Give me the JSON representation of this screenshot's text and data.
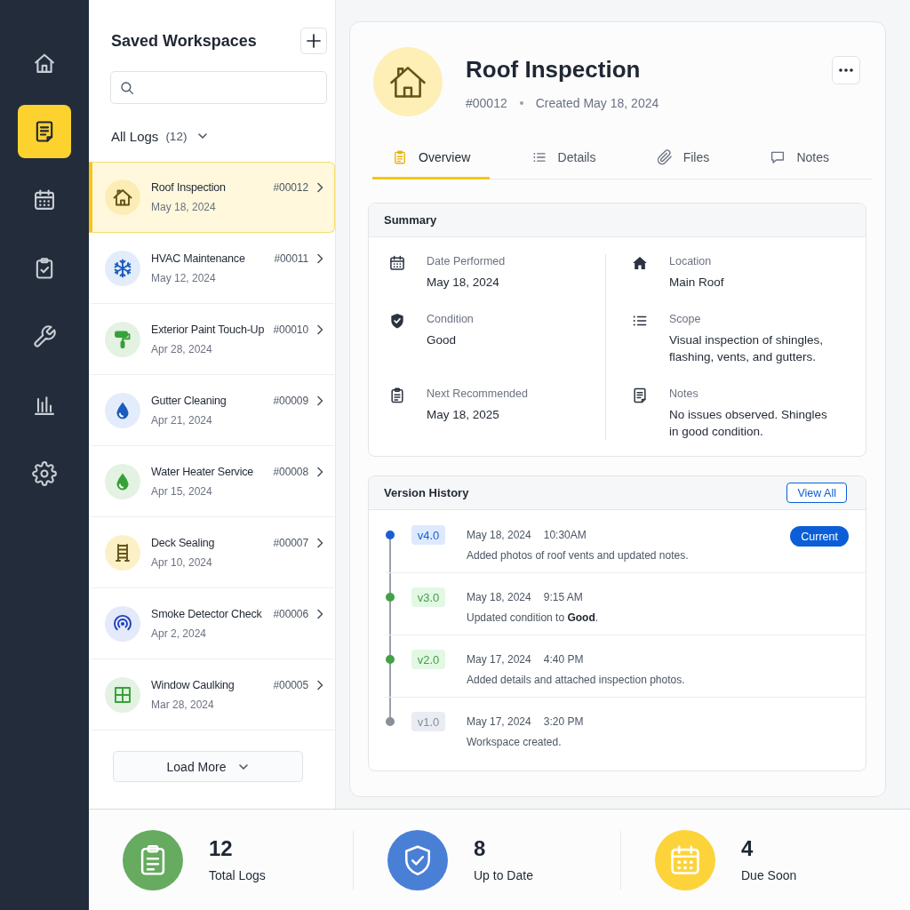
{
  "nav": [
    {
      "kind": "home",
      "selected": false
    },
    {
      "kind": "document",
      "selected": true
    },
    {
      "kind": "calendar",
      "selected": false
    },
    {
      "kind": "clipboard-check",
      "selected": false
    },
    {
      "kind": "wrench",
      "selected": false
    },
    {
      "kind": "chart",
      "selected": false
    },
    {
      "kind": "gear",
      "selected": false
    }
  ],
  "sidebar": {
    "title": "Saved Workspaces",
    "filter": {
      "label": "All Logs",
      "count": "(12)"
    },
    "items": [
      {
        "kind": "house",
        "color": "#fcedb6",
        "title": "Roof Inspection",
        "id": "#00012",
        "date": "May 18, 2024",
        "selected": true
      },
      {
        "kind": "snowflake",
        "color": "#e2ecfb",
        "title": "HVAC Maintenance",
        "id": "#00011",
        "date": "May 12, 2024",
        "selected": false
      },
      {
        "kind": "roller",
        "color": "#e3f2e3",
        "title": "Exterior Paint Touch-Up",
        "id": "#00010",
        "date": "Apr 28, 2024",
        "selected": false
      },
      {
        "kind": "drop",
        "color": "#e2ecfb",
        "title": "Gutter Cleaning",
        "id": "#00009",
        "date": "Apr 21, 2024",
        "selected": false
      },
      {
        "kind": "drop",
        "color": "#e3f2e3",
        "title": "Water Heater Service",
        "id": "#00008",
        "date": "Apr 15, 2024",
        "selected": false
      },
      {
        "kind": "ladder",
        "color": "#fcf1c6",
        "title": "Deck Sealing",
        "id": "#00007",
        "date": "Apr 10, 2024",
        "selected": false
      },
      {
        "kind": "detector",
        "color": "#e4e9fb",
        "title": "Smoke Detector Check",
        "id": "#00006",
        "date": "Apr 2, 2024",
        "selected": false
      },
      {
        "kind": "window",
        "color": "#e3f2e3",
        "title": "Window Caulking",
        "id": "#00005",
        "date": "Mar 28, 2024",
        "selected": false
      }
    ],
    "load_more": "Load More"
  },
  "detail": {
    "kind": "house",
    "color": "#fdefb5",
    "title": "Roof Inspection",
    "id": "#00012",
    "created": "Created May 18, 2024",
    "tabs": [
      {
        "kind": "clipboard",
        "label": "Overview",
        "selected": true
      },
      {
        "kind": "list",
        "label": "Details",
        "selected": false
      },
      {
        "kind": "paperclip",
        "label": "Files",
        "selected": false
      },
      {
        "kind": "comment",
        "label": "Notes",
        "selected": false
      }
    ],
    "summary": {
      "title": "Summary",
      "fields": [
        {
          "kind": "calendar",
          "label": "Date Performed",
          "value": "May 18, 2024"
        },
        {
          "kind": "house",
          "label": "Location",
          "value": "Main Roof"
        },
        {
          "kind": "shield",
          "label": "Condition",
          "value": "Good"
        },
        {
          "kind": "list",
          "label": "Scope",
          "value": "Visual inspection of shingles, flashing, vents, and gutters."
        },
        {
          "kind": "clipboard",
          "label": "Next Recommended",
          "value": "May 18, 2025"
        },
        {
          "kind": "document",
          "label": "Notes",
          "value": "No issues observed. Shingles in good condition."
        }
      ]
    },
    "history": {
      "title": "Version History",
      "view_all": "View All",
      "versions": [
        {
          "version": "v4.0",
          "color": "#1a5fd0",
          "date": "May 18, 2024",
          "time": "10:30AM",
          "note": "Added photos of roof vents and updated notes.",
          "tag": "Current"
        },
        {
          "version": "v3.0",
          "color": "#43a047",
          "date": "May 18, 2024",
          "time": "9:15 AM",
          "note": "Updated condition to **Good**."
        },
        {
          "version": "v2.0",
          "color": "#43a047",
          "date": "May 17, 2024",
          "time": "4:40 PM",
          "note": "Added details and attached inspection photos."
        },
        {
          "version": "v1.0",
          "color": "#8a8f98",
          "date": "May 17, 2024",
          "time": "3:20 PM",
          "note": "Workspace created."
        }
      ]
    }
  },
  "stats": [
    {
      "kind": "clipboard",
      "color": "#66ab5f",
      "value": "12",
      "label": "Total Logs"
    },
    {
      "kind": "shield",
      "color": "#4a7fd6",
      "value": "8",
      "label": "Up to Date"
    },
    {
      "kind": "calendar",
      "color": "#fdd33a",
      "value": "4",
      "label": "Due Soon"
    }
  ]
}
